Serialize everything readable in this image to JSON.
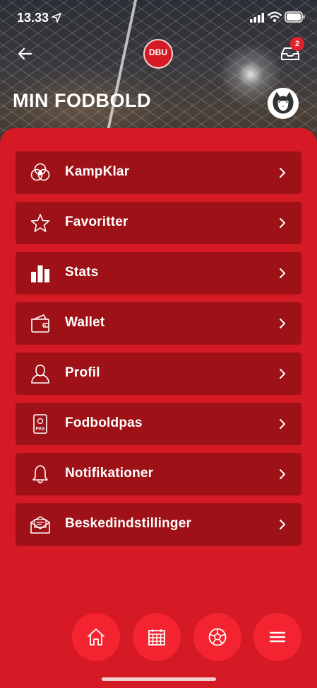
{
  "status_bar": {
    "time": "13.33"
  },
  "header": {
    "logo_text": "DBU",
    "notification_count": "2",
    "title": "MIN FODBOLD"
  },
  "menu": [
    {
      "label": "KampKlar",
      "icon": "kampklar-icon"
    },
    {
      "label": "Favoritter",
      "icon": "star-icon"
    },
    {
      "label": "Stats",
      "icon": "bar-chart-icon"
    },
    {
      "label": "Wallet",
      "icon": "wallet-icon"
    },
    {
      "label": "Profil",
      "icon": "profile-icon"
    },
    {
      "label": "Fodboldpas",
      "icon": "passport-icon"
    },
    {
      "label": "Notifikationer",
      "icon": "bell-icon"
    },
    {
      "label": "Beskedindstillinger",
      "icon": "envelope-icon"
    }
  ],
  "bottom_nav": [
    {
      "name": "home",
      "icon": "home-icon"
    },
    {
      "name": "calendar",
      "icon": "calendar-icon"
    },
    {
      "name": "football",
      "icon": "football-icon"
    },
    {
      "name": "menu",
      "icon": "hamburger-icon"
    }
  ],
  "colors": {
    "brand_red": "#d51a26",
    "row_dark_red": "#9e1116",
    "fab_red": "#f3232f"
  }
}
